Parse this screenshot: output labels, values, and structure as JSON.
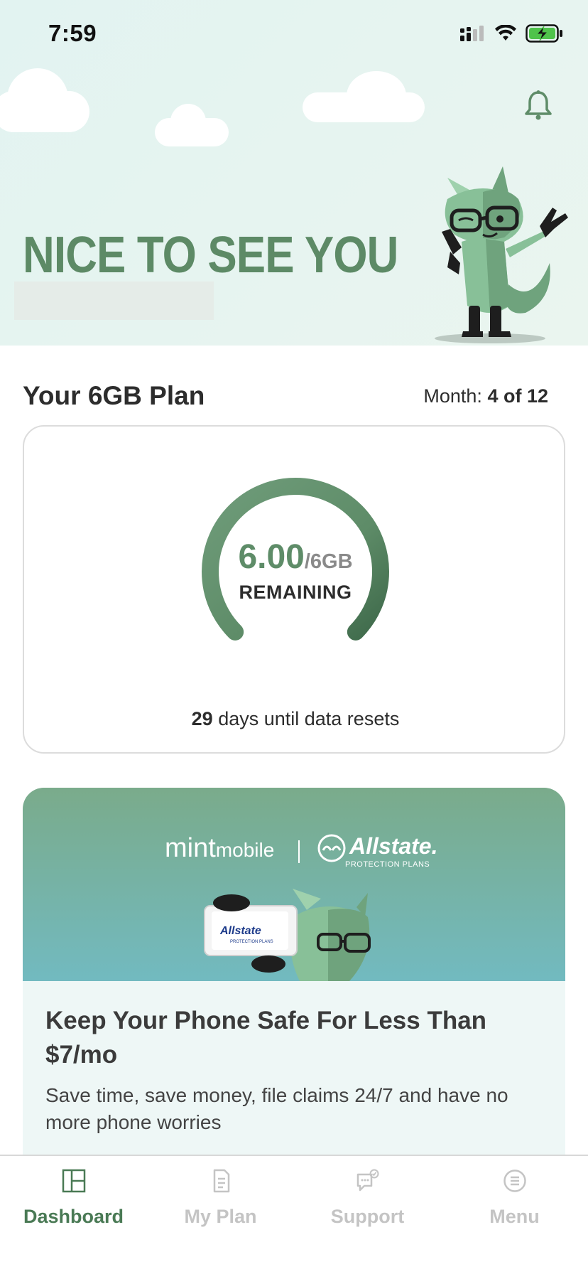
{
  "status": {
    "time": "7:59"
  },
  "hero": {
    "greeting": "NICE TO SEE YOU"
  },
  "plan": {
    "title": "Your 6GB Plan",
    "month_label": "Month:",
    "month_value": "4 of 12",
    "remaining_value": "6.00",
    "remaining_total": "/6GB",
    "remaining_label": "REMAINING",
    "remaining_fraction": 1.0,
    "reset_days": "29",
    "reset_text": " days until data resets"
  },
  "promo": {
    "mint_brand": "mint",
    "mint_brand_small": "mobile",
    "allstate_brand": "Allstate.",
    "allstate_sub": "PROTECTION PLANS",
    "device_brand": "Allstate",
    "device_sub": "PROTECTION PLANS",
    "title": "Keep Your Phone Safe For Less Than $7/mo",
    "text": "Save time, save money, file claims 24/7 and have no more phone worries"
  },
  "nav": {
    "items": [
      {
        "label": "Dashboard",
        "icon": "dashboard-icon",
        "active": true
      },
      {
        "label": "My Plan",
        "icon": "sim-card-icon",
        "active": false
      },
      {
        "label": "Support",
        "icon": "chat-support-icon",
        "active": false
      },
      {
        "label": "Menu",
        "icon": "menu-icon",
        "active": false
      }
    ]
  },
  "colors": {
    "brand_green": "#5e8c68",
    "nav_active": "#4a7a55",
    "nav_inactive": "#c4c4c4"
  }
}
